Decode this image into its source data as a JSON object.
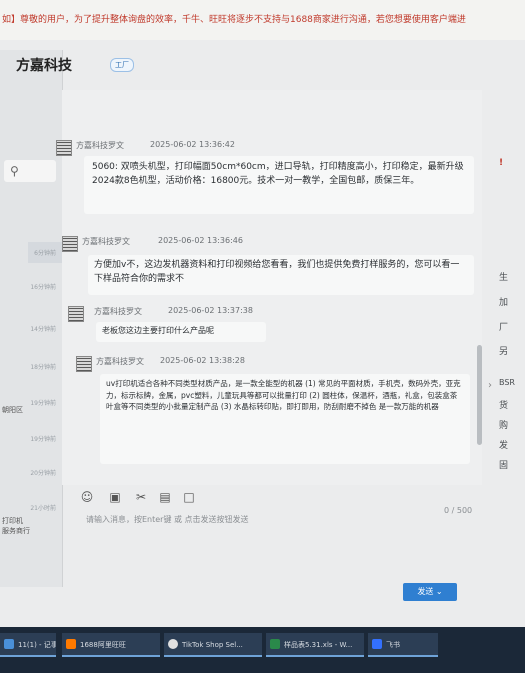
{
  "banner": {
    "text": "如】尊敬的用户，为了提升整体询盘的效率，千牛、旺旺将逐步不支持与1688商家进行沟通，若您想要使用客户端进"
  },
  "header": {
    "title": "方嘉科技",
    "badge": "工厂"
  },
  "left": {
    "search_icon": "search-icon",
    "items": [
      "6分钟前",
      "16分钟前",
      "14分钟前",
      "18分钟前",
      "19分钟前",
      "19分钟前",
      "20分钟前",
      "21小时前"
    ],
    "texts": [
      "朝阳区",
      "打印机",
      "服务商行"
    ]
  },
  "messages": [
    {
      "sender": "方嘉科技罗文",
      "time": "2025-06-02 13:36:42",
      "text": "5060: 双喷头机型，打印幅面50cm*60cm，进口导轨，打印精度高小，打印稳定，最新升级2024款8色机型，活动价格：16800元。技术一对一教学，全国包邮，质保三年。"
    },
    {
      "sender": "方嘉科技罗文",
      "time": "2025-06-02 13:36:46",
      "text": "方便加v不，这边发机器资料和打印视频给您看看，我们也提供免费打样服务的，您可以看一下样品符合你的需求不"
    },
    {
      "sender": "方嘉科技罗文",
      "time": "2025-06-02 13:37:38",
      "text": "老板您这边主要打印什么产品呢"
    },
    {
      "sender": "方嘉科技罗文",
      "time": "2025-06-02 13:38:28",
      "text": "uv打印机适合各种不同类型材质产品，是一款全能型的机器 (1) 常见的平面材质，手机壳，数码外壳，亚克力，标示标牌，金属，pvc塑料，儿童玩具等都可以批量打印 (2) 圆柱体，保温杯，酒瓶，礼盒，包装盒茶叶盒等不同类型的小批量定制产品 (3) 水晶标转印贴，即打即用，防刮耐磨不掉色 是一款万能的机器"
    }
  ],
  "toolbar": [
    "emoji-icon",
    "image-icon",
    "scissors-icon",
    "file-icon",
    "message-icon"
  ],
  "input": {
    "placeholder": "请输入消息，按Enter键 或 点击发送按钮发送",
    "counter": "0 / 500"
  },
  "send_button": {
    "label": "发送"
  },
  "right_strip": [
    "!",
    "生",
    "加",
    "厂",
    "另",
    "BSR",
    "货",
    "购",
    "发",
    "固"
  ],
  "taskbar": [
    {
      "label": "11(1) - 记事本",
      "color": "#4a90d9"
    },
    {
      "label": "1688阿里旺旺",
      "color": "#ff7a00"
    },
    {
      "label": "TikTok Shop Sel...",
      "color": "#e0e0e0"
    },
    {
      "label": "样品表5.31.xls - W...",
      "color": "#2a8a4a"
    },
    {
      "label": "飞书",
      "color": "#3370ff"
    }
  ],
  "colors": {
    "accent": "#2f7fd1",
    "taskbar": "#1b2838",
    "banner_text": "#c0392b"
  }
}
